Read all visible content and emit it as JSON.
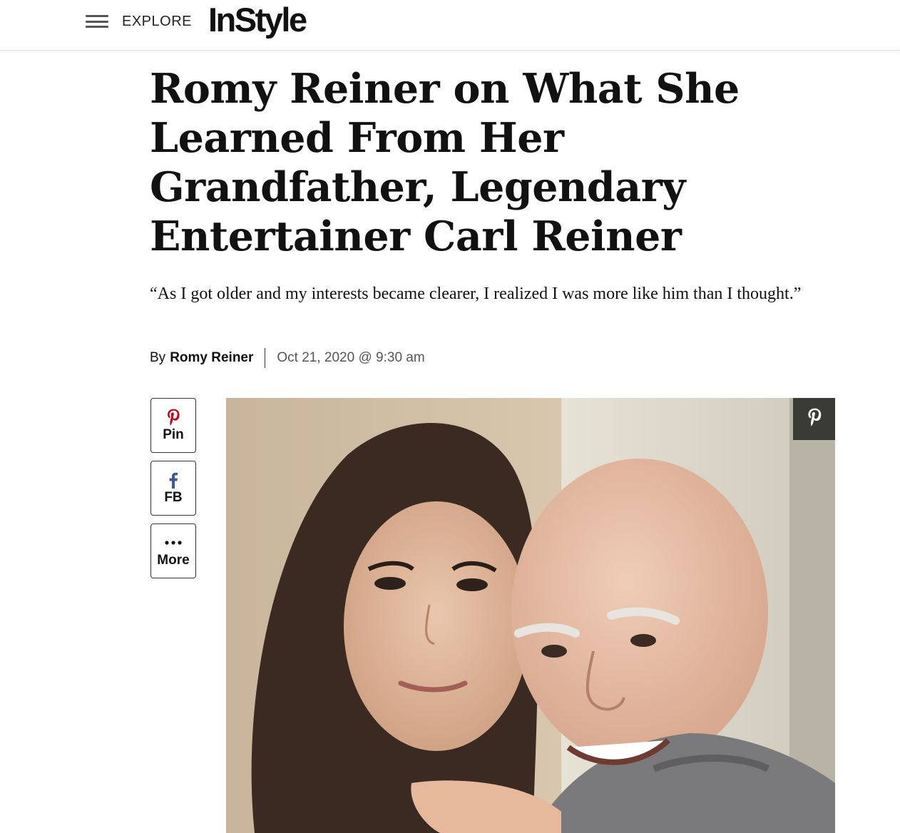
{
  "header": {
    "explore_label": "EXPLORE",
    "logo_text": "InStyle",
    "menu_icon": "hamburger-icon"
  },
  "article": {
    "headline": "Romy Reiner on What She Learned From Her Grandfather, Legendary Entertainer Carl Reiner",
    "dek": "“As I got older and my interests became clearer, I realized I was more like him than I thought.”",
    "byline": {
      "prefix": "By",
      "author": "Romy Reiner",
      "date": "Oct 21, 2020 @ 9:30 am"
    }
  },
  "share": {
    "pin": {
      "label": "Pin",
      "icon": "pinterest-icon",
      "color": "#bd081c"
    },
    "fb": {
      "label": "FB",
      "icon": "facebook-icon",
      "color": "#3b5998"
    },
    "more": {
      "label": "More",
      "icon": "ellipsis-icon"
    }
  },
  "hero_image": {
    "overlay_icon": "pinterest-icon"
  },
  "colors": {
    "text": "#111111",
    "muted": "#555555",
    "pin_overlay_bg": "#3a3a36"
  }
}
